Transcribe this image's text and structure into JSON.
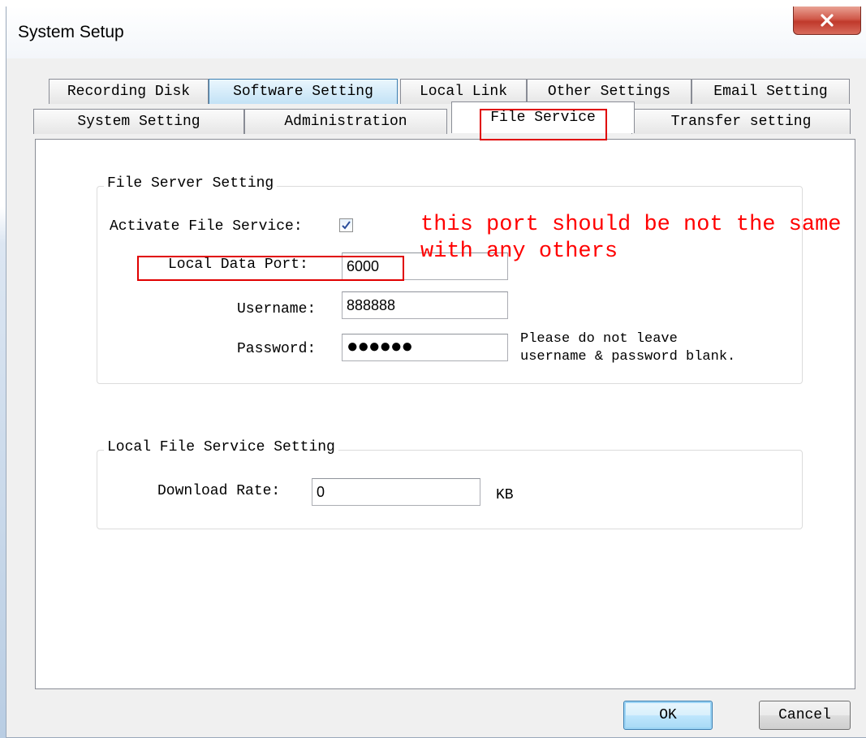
{
  "window": {
    "title": "System Setup"
  },
  "tabs_row1": [
    {
      "label": "Recording Disk"
    },
    {
      "label": "Software Setting"
    },
    {
      "label": "Local Link"
    },
    {
      "label": "Other Settings"
    },
    {
      "label": "Email Setting"
    }
  ],
  "tabs_row2": [
    {
      "label": "System Setting"
    },
    {
      "label": "Administration"
    },
    {
      "label": "File Service"
    },
    {
      "label": "Transfer setting"
    }
  ],
  "file_server": {
    "group_title": "File Server Setting",
    "activate_label": "Activate File Service:",
    "activate_checked": true,
    "port_label": "Local Data Port:",
    "port_value": "6000",
    "username_label": "Username:",
    "username_value": "888888",
    "password_label": "Password:",
    "password_value": "●●●●●●",
    "hint_line1": "Please do not leave",
    "hint_line2": "username & password blank."
  },
  "local_file_service": {
    "group_title": "Local File Service Setting",
    "download_label": "Download Rate:",
    "download_value": "0",
    "unit": "KB"
  },
  "annotation": {
    "line1": "this port should be not the same",
    "line2": "with any others"
  },
  "buttons": {
    "ok": "OK",
    "cancel": "Cancel"
  },
  "colors": {
    "annotation": "#ff0000",
    "close_button": "#c0392b"
  }
}
